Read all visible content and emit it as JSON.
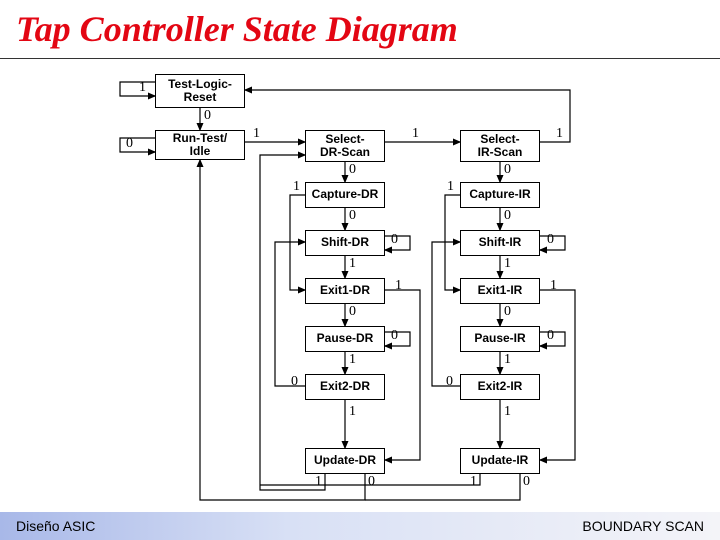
{
  "title": "Tap Controller State Diagram",
  "footer": {
    "left": "Diseño ASIC",
    "right": "BOUNDARY SCAN"
  },
  "states": {
    "tlr": "Test-Logic-\nReset",
    "rti": "Run-Test/\nIdle",
    "sdr": "Select-\nDR-Scan",
    "sir": "Select-\nIR-Scan",
    "cdr": "Capture-DR",
    "cir": "Capture-IR",
    "shdr": "Shift-DR",
    "shir": "Shift-IR",
    "e1dr": "Exit1-DR",
    "e1ir": "Exit1-IR",
    "pdr": "Pause-DR",
    "pir": "Pause-IR",
    "e2dr": "Exit2-DR",
    "e2ir": "Exit2-IR",
    "udr": "Update-DR",
    "uir": "Update-IR"
  },
  "labels": {
    "l0": "0",
    "l1": "1"
  }
}
